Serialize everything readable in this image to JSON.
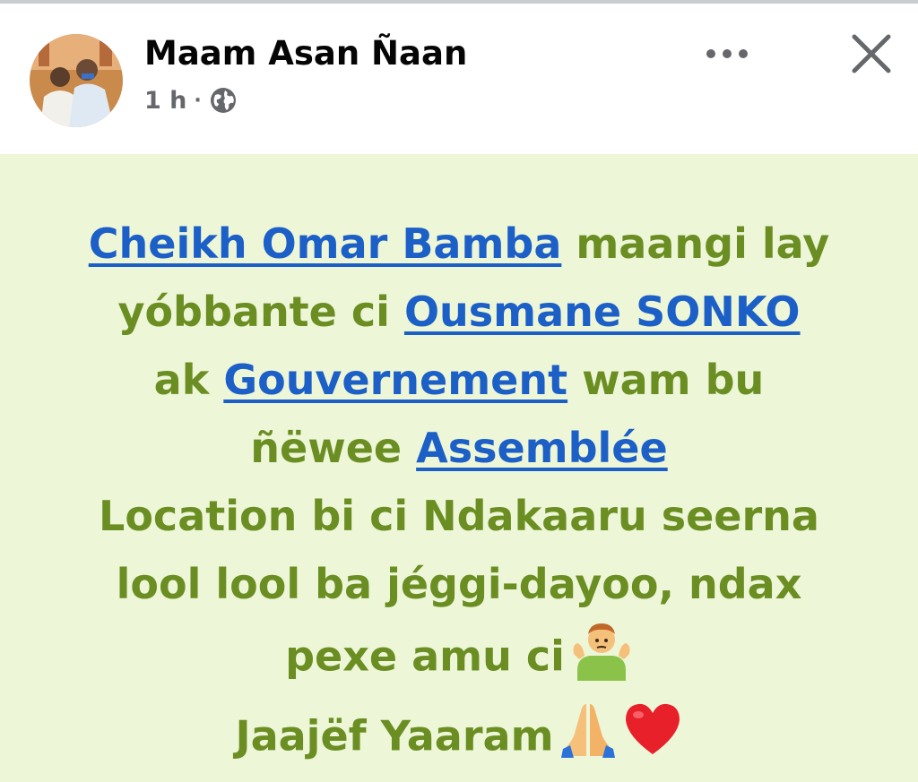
{
  "post": {
    "author": "Maam Asan Ñaan",
    "time": "1 h",
    "separator": "·",
    "icons": {
      "privacy": "globe-icon",
      "more": "more-options-icon",
      "close": "close-icon"
    },
    "text": {
      "tag_1": "Cheikh Omar Bamba",
      "part_1": " maangi lay",
      "part_2": "yóbbante ci ",
      "tag_2": "Ousmane SONKO",
      "part_3": "ak ",
      "tag_3": "Gouvernement",
      "part_4": " wam bu",
      "part_5": "ñëwee ",
      "tag_4": "Assemblée",
      "line_5": "Location bi ci Ndakaaru seerna",
      "line_6": "lool lool ba jéggi-dayoo, ndax",
      "line_7": "pexe amu ci",
      "line_8": "Jaajëf Yaaram"
    },
    "emojis": {
      "shrug": "shrugging-man-emoji",
      "pray": "folded-hands-emoji",
      "heart": "red-heart-emoji"
    },
    "colors": {
      "background": "#eef6d8",
      "text": "#6b8e23",
      "tag": "#1b5fc7"
    }
  }
}
